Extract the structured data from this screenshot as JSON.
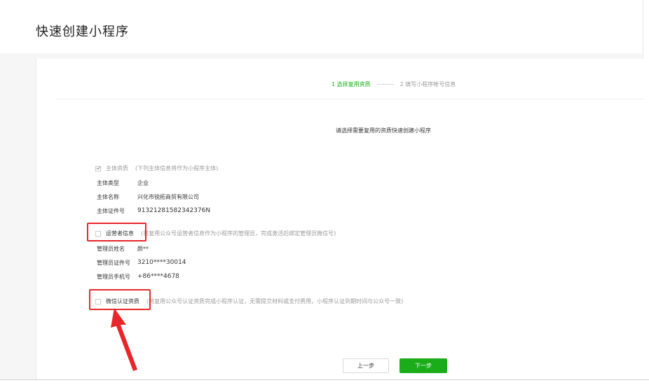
{
  "page": {
    "title": "快速创建小程序"
  },
  "steps": [
    {
      "label": "1 选择复用资质",
      "active": true
    },
    {
      "label": "2 填写小程序帐号信息",
      "active": false
    }
  ],
  "intro": "请选择需要复用的资质快速创建小程序",
  "sections": {
    "subject": {
      "label": "主体资质",
      "hint": "(下列主体信息将作为小程序主体)",
      "checked": true,
      "fields": [
        {
          "key": "主体类型",
          "value": "企业"
        },
        {
          "key": "主体名称",
          "value": "兴化市锐拓商贸有限公司"
        },
        {
          "key": "主体证件号",
          "value": "91321281582342376N"
        }
      ]
    },
    "operator": {
      "label": "运营者信息",
      "hint": "(将复用公众号运营者信息作为小程序的管理员，完成激活后绑定管理员微信号)",
      "checked": false,
      "fields": [
        {
          "key": "管理员姓名",
          "value": "颜**"
        },
        {
          "key": "管理员证件号",
          "value": "3210****30014"
        },
        {
          "key": "管理员手机号",
          "value": "+86****4678"
        }
      ]
    },
    "verify": {
      "label": "微信认证资质",
      "hint": "(将复用公众号认证资质完成小程序认证，无需提交材料或支付费用，小程序认证到期时间与公众号一致)",
      "checked": false
    }
  },
  "buttons": {
    "prev": "上一步",
    "next": "下一步"
  },
  "colors": {
    "accent": "#1aad19",
    "highlight": "#e8262a"
  }
}
